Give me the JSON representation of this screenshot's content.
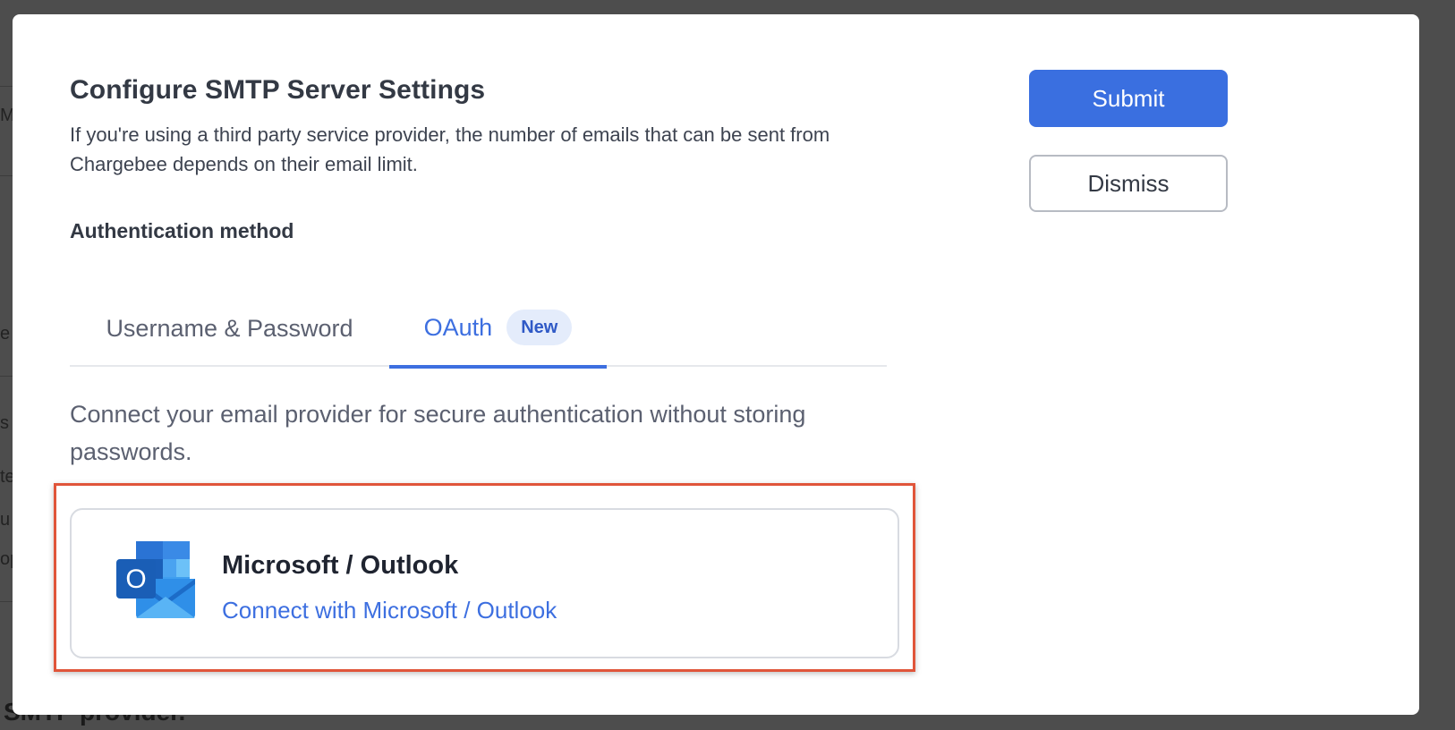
{
  "backdrop": {
    "fragments": [
      "M",
      "e",
      "s",
      "te",
      "u",
      "op"
    ],
    "footer_text": "SMTP provider."
  },
  "modal": {
    "title": "Configure SMTP Server Settings",
    "description": "If you're using a third party service provider, the number of emails that can be sent from Chargebee depends on their email limit.",
    "section_label": "Authentication method",
    "tabs": [
      {
        "label": "Username & Password",
        "active": false
      },
      {
        "label": "OAuth",
        "active": true,
        "badge": "New"
      }
    ],
    "oauth_description": "Connect your email provider for secure authentication without storing passwords.",
    "provider": {
      "icon": "outlook-icon",
      "name": "Microsoft / Outlook",
      "link_label": "Connect with Microsoft / Outlook"
    },
    "actions": {
      "submit_label": "Submit",
      "dismiss_label": "Dismiss"
    }
  },
  "colors": {
    "accent": "#3a6fe0",
    "highlight": "#e0553a",
    "badge_bg": "#e4ecfb"
  }
}
